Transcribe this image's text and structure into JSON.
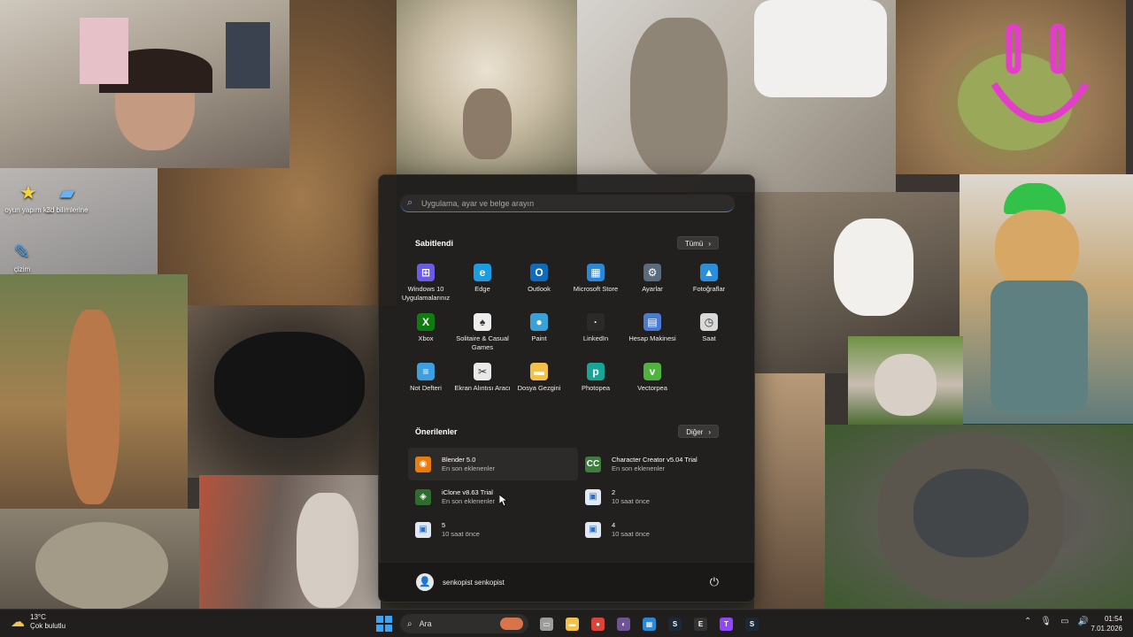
{
  "desktop": {
    "icons": [
      {
        "label": "oyun yapım kiti",
        "glyph": "star-icon"
      },
      {
        "label": "3d bilimlerine",
        "glyph": "folder-icon"
      },
      {
        "label": "çizim",
        "glyph": "paint-icon"
      }
    ]
  },
  "start_menu": {
    "search_placeholder": "Uygulama, ayar ve belge arayın",
    "pinned_title": "Sabitlendi",
    "pinned_button": "Tümü",
    "pinned_apps": [
      {
        "label": "Windows 10 Uygulamalarınız",
        "icon": "windows-apps-icon",
        "color": "#6b5ce7",
        "glyph": "⊞"
      },
      {
        "label": "Edge",
        "icon": "edge-icon",
        "color": "#1b9de2",
        "glyph": "e"
      },
      {
        "label": "Outlook",
        "icon": "outlook-icon",
        "color": "#0f6cbd",
        "glyph": "O"
      },
      {
        "label": "Microsoft Store",
        "icon": "store-icon",
        "color": "#2b88d8",
        "glyph": "▦"
      },
      {
        "label": "Ayarlar",
        "icon": "gear-icon",
        "color": "#5a6b7d",
        "glyph": "⚙"
      },
      {
        "label": "Fotoğraflar",
        "icon": "photos-icon",
        "color": "#2a8fd8",
        "glyph": "▲"
      },
      {
        "label": "Xbox",
        "icon": "xbox-icon",
        "color": "#107c10",
        "glyph": "X"
      },
      {
        "label": "Solitaire & Casual Games",
        "icon": "solitaire-icon",
        "color": "#eeeeee",
        "glyph": "♠"
      },
      {
        "label": "Paint",
        "icon": "paint-icon",
        "color": "#3aa0d8",
        "glyph": "●"
      },
      {
        "label": "LinkedIn",
        "icon": "linkedin-icon",
        "color": "#2b2a29",
        "glyph": "·"
      },
      {
        "label": "Hesap Makinesi",
        "icon": "calculator-icon",
        "color": "#4a7bd0",
        "glyph": "▤"
      },
      {
        "label": "Saat",
        "icon": "clock-icon",
        "color": "#d9d9d9",
        "glyph": "◷"
      },
      {
        "label": "Not Defteri",
        "icon": "notepad-icon",
        "color": "#3b9fe0",
        "glyph": "≡"
      },
      {
        "label": "Ekran Alıntısı Aracı",
        "icon": "snipping-tool-icon",
        "color": "#e8e8e8",
        "glyph": "✂"
      },
      {
        "label": "Dosya Gezgini",
        "icon": "folder-icon",
        "color": "#f4c04a",
        "glyph": "▬"
      },
      {
        "label": "Photopea",
        "icon": "photopea-icon",
        "color": "#18a497",
        "glyph": "p"
      },
      {
        "label": "Vectorpea",
        "icon": "vectorpea-icon",
        "color": "#4fb33e",
        "glyph": "v"
      }
    ],
    "recommended_title": "Önerilenler",
    "recommended_button": "Diğer",
    "recommended": [
      {
        "name": "Blender 5.0",
        "sub": "En son eklenenler",
        "icon": "blender-icon",
        "color": "#e87d0d",
        "glyph": "◉"
      },
      {
        "name": "Character Creator v5.04 Trial",
        "sub": "En son eklenenler",
        "icon": "character-creator-icon",
        "color": "#3e7d3e",
        "glyph": "CC"
      },
      {
        "name": "iClone v8.63 Trial",
        "sub": "En son eklenenler",
        "icon": "iclone-icon",
        "color": "#2f6d2f",
        "glyph": "◈"
      },
      {
        "name": "2",
        "sub": "10 saat önce",
        "icon": "image-file-icon",
        "color": "#dfe8f3",
        "glyph": "▣"
      },
      {
        "name": "5",
        "sub": "10 saat önce",
        "icon": "image-file-icon",
        "color": "#dfe8f3",
        "glyph": "▣"
      },
      {
        "name": "4",
        "sub": "10 saat önce",
        "icon": "image-file-icon",
        "color": "#dfe8f3",
        "glyph": "▣"
      }
    ],
    "user_name": "senkopist senkopist"
  },
  "taskbar": {
    "weather_temp": "13°C",
    "weather_desc": "Çok bulutlu",
    "search_label": "Ara",
    "apps": [
      {
        "name": "task-view-icon",
        "color": "#9c9c9c",
        "glyph": "▭"
      },
      {
        "name": "file-explorer-icon",
        "color": "#f4c04a",
        "glyph": "▬"
      },
      {
        "name": "chrome-icon",
        "color": "#db4437",
        "glyph": "●"
      },
      {
        "name": "github-desktop-icon",
        "color": "#6e5494",
        "glyph": "◐"
      },
      {
        "name": "store-icon",
        "color": "#2b88d8",
        "glyph": "▦"
      },
      {
        "name": "steam-icon",
        "color": "#1b2838",
        "glyph": "S"
      },
      {
        "name": "epic-games-icon",
        "color": "#333333",
        "glyph": "E"
      },
      {
        "name": "twitch-icon",
        "color": "#9146ff",
        "glyph": "T"
      },
      {
        "name": "steam-alt-icon",
        "color": "#1b2838",
        "glyph": "S"
      }
    ],
    "time": "01:54",
    "date": "7.01.2026"
  }
}
